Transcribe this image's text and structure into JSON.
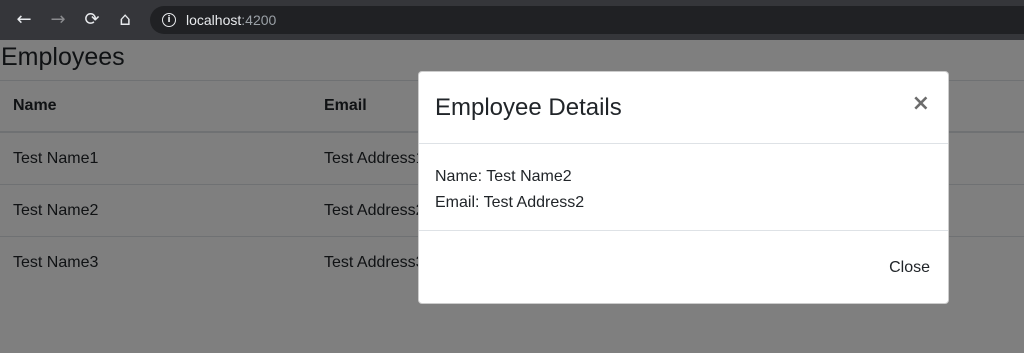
{
  "browser": {
    "nav": {
      "back_icon": "←",
      "forward_icon": "→",
      "reload_icon": "⟳",
      "home_icon": "⌂"
    },
    "info_icon": "i",
    "url_host": "localhost",
    "url_port": ":4200"
  },
  "page": {
    "title": "Employees",
    "table": {
      "headers": [
        "Name",
        "Email"
      ],
      "rows": [
        [
          "Test Name1",
          "Test Address1"
        ],
        [
          "Test Name2",
          "Test Address2"
        ],
        [
          "Test Name3",
          "Test Address3"
        ]
      ]
    }
  },
  "modal": {
    "title": "Employee Details",
    "close_icon": "×",
    "name_line": "Name: Test Name2",
    "email_line": "Email: Test Address2",
    "close_label": "Close"
  }
}
